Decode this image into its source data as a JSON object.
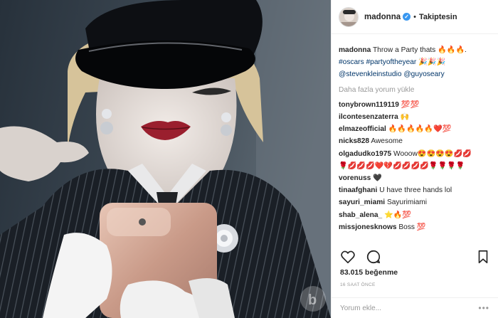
{
  "header": {
    "username": "madonna",
    "verified_mark": "✓",
    "separator": "•",
    "follow_label": "Takiptesin"
  },
  "caption": {
    "username": "madonna",
    "text": "Throw a Party thats",
    "emojis": "🔥🔥🔥.",
    "hashtags": "#oscars #partyoftheyear",
    "hashtag_emojis": "🎉🎉🎉",
    "mentions": "@stevenkleinstudio @guyoseary"
  },
  "load_more": "Daha fazla yorum yükle",
  "comments": [
    {
      "user": "tonybrown119119",
      "text": "💯💯"
    },
    {
      "user": "ilcontesenzaterra",
      "text": "🙌"
    },
    {
      "user": "elmazeofficial",
      "text": "🔥🔥🔥🔥🔥❤️💯"
    },
    {
      "user": "nicks828",
      "text": "Awesome"
    },
    {
      "user": "olgadudko1975",
      "text": "Wooow😍😍😍😍💋💋"
    },
    {
      "user": "",
      "text": "🌹💋💋💋❤️💔💋💋💋💋🌹🌹🌹🌹"
    },
    {
      "user": "vorenuss",
      "text": "🖤"
    },
    {
      "user": "tinaafghani",
      "text": "U have three hands lol"
    },
    {
      "user": "sayuri_miami",
      "text": "Sayurimiami"
    },
    {
      "user": "shab_alena_",
      "text": "⭐🔥💯"
    },
    {
      "user": "missjonesknows",
      "text": "Boss 💯"
    }
  ],
  "actions": {
    "like_icon": "heart-icon",
    "comment_icon": "comment-icon",
    "save_icon": "bookmark-icon"
  },
  "likes_text": "83.015 beğenme",
  "timestamp": "16 SAAT ÖNCE",
  "add_comment": {
    "placeholder": "Yorum ekle...",
    "more": "•••"
  },
  "colors": {
    "verified": "#3897f0",
    "link": "#003569",
    "muted": "#999999",
    "border": "#efefef"
  }
}
